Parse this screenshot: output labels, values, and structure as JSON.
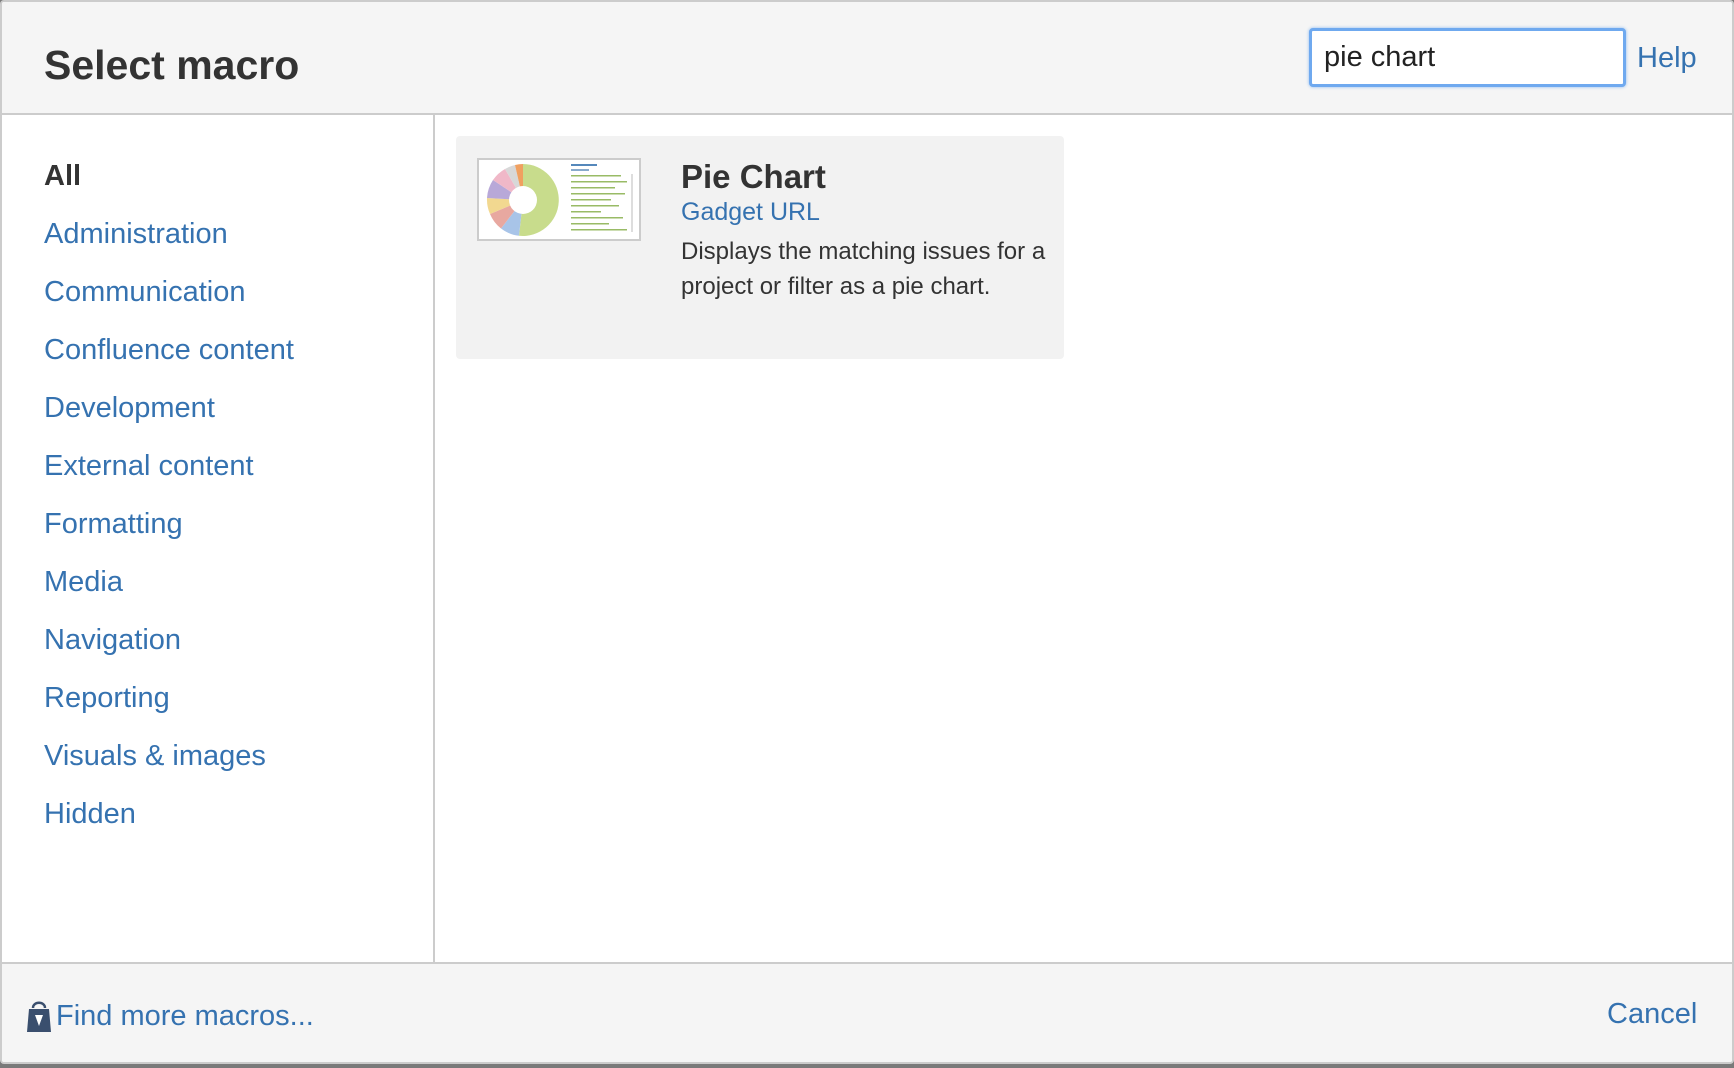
{
  "dialog": {
    "title": "Select macro",
    "search": {
      "value": "pie chart",
      "placeholder": ""
    },
    "help_label": "Help"
  },
  "sidebar": {
    "items": [
      {
        "label": "All",
        "selected": true
      },
      {
        "label": "Administration",
        "selected": false
      },
      {
        "label": "Communication",
        "selected": false
      },
      {
        "label": "Confluence content",
        "selected": false
      },
      {
        "label": "Development",
        "selected": false
      },
      {
        "label": "External content",
        "selected": false
      },
      {
        "label": "Formatting",
        "selected": false
      },
      {
        "label": "Media",
        "selected": false
      },
      {
        "label": "Navigation",
        "selected": false
      },
      {
        "label": "Reporting",
        "selected": false
      },
      {
        "label": "Visuals & images",
        "selected": false
      },
      {
        "label": "Hidden",
        "selected": false
      }
    ]
  },
  "results": [
    {
      "name": "Pie Chart",
      "source": "Gadget URL",
      "description": "Displays the matching issues for a project or filter as a pie chart.",
      "thumbnail_icon": "pie-chart-thumbnail"
    }
  ],
  "footer": {
    "find_more_label": "Find more macros...",
    "find_more_icon": "marketplace-bag-icon",
    "cancel_label": "Cancel"
  },
  "colors": {
    "link": "#3572b0",
    "header_bg": "#f5f5f5",
    "card_bg": "#f2f2f2",
    "focus": "#6fa9ef"
  }
}
